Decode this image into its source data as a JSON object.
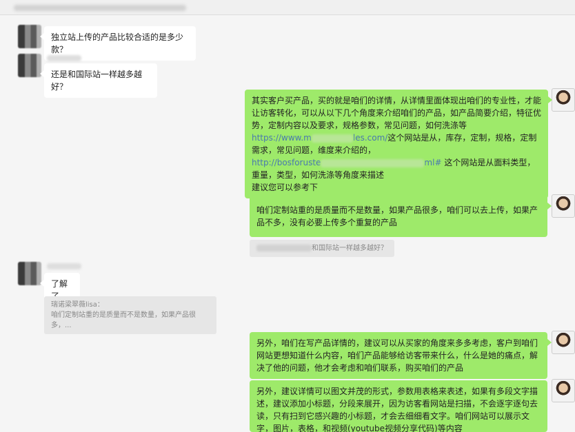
{
  "messages": {
    "m1": "独立站上传的产品比较合适的是多少款？",
    "m2": "还是和国际站一样越多越好？",
    "m3": {
      "p1": "其实客户买产品，买的就是咱们的详情，从详情里面体现出咱们的专业性，才能让访客转化，可以从以下几个角度来介绍咱们的产品，如产品简要介绍，特征优势，定制内容以及要求，规格参数，常见问题，如何洗涤等",
      "link1a": "https://www.m",
      "link1b": "les.com/",
      "p2": "这个网站是从，库存，定制，规格，定制需求，常见问题，维度来介绍的，",
      "link2a": "http://bosforuste",
      "link2b": "ml#",
      "p3": " 这个网站是从面料类型，重量，类型，如何洗涤等角度来描述",
      "p4": "建议您可以参考下"
    },
    "m4": "咱们定制站重的是质量而不是数量，如果产品很多，咱们可以去上传，如果产品不多，没有必要上传多个重复的产品",
    "m4_quote": "和国际站一样越多越好？",
    "m5": "了解了",
    "m5_quote_name": "瑞诺梁翠薇lisa：",
    "m5_quote_text": "咱们定制站重的是质量而不是数量，如果产品很多，...",
    "m6": "另外，咱们在写产品详情的，建议可以从买家的角度来多多考虑，客户到咱们网站更想知道什么内容，咱们产品能够给访客带来什么，什么是她的痛点，解决了他的问题，他才会考虑和咱们联系，购买咱们的产品",
    "m7": "另外，建议详情可以图文并茂的形式，参数用表格来表述，如果有多段文字描述，建议添加小标题，分段来展开，因为访客看网站是扫描，不会逐字逐句去读，只有扫到它感兴趣的小标题，才会去细细看文字。咱们网站可以展示文字，图片，表格，和视频(youtube视频分享代码)等内容"
  }
}
